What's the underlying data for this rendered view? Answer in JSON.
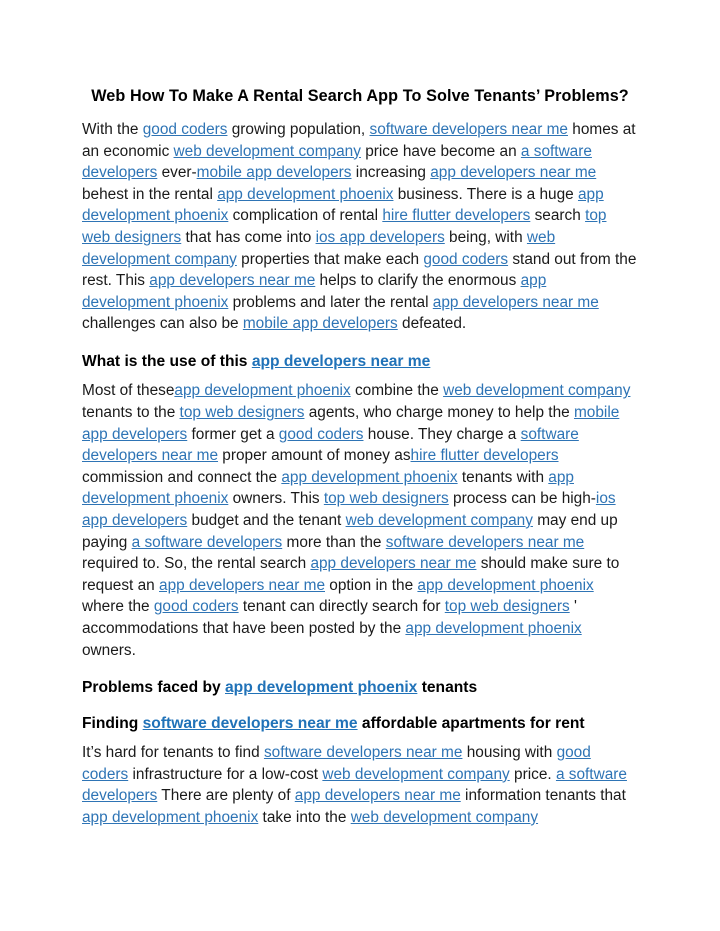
{
  "document": {
    "title": "Web How To Make A Rental Search App To Solve Tenants’ Problems?",
    "link_color": "#2E74B5",
    "text_color": "#1a1a1a",
    "background_color": "#ffffff"
  },
  "paragraph1": {
    "s1": "With the ",
    "l1": "good coders",
    "s2": " growing population, ",
    "l2": "software developers near me",
    "s3": " homes at an economic ",
    "l3": "web development company",
    "s4": " price have become an ",
    "l4": "a software developers",
    "s5": " ever-",
    "l5": "mobile app developers",
    "s6": " increasing ",
    "l6": "app developers near me",
    "s7": " behest in the rental ",
    "l7": "app development phoenix",
    "s8": " business. There is a huge ",
    "l8": "app development phoenix",
    "s9": " complication of rental ",
    "l9": "hire flutter developers",
    "s10": " search ",
    "l10": "top web designers",
    "s11": " that has come into ",
    "l11": "ios app developers",
    "s12": " being, with ",
    "l12": "web development company",
    "s13": " properties that make each ",
    "l13": "good coders",
    "s14": " stand out from the rest. This ",
    "l14": "app developers near me",
    "s15": " helps to clarify the enormous ",
    "l15": "app development phoenix",
    "s16": " problems and later the rental ",
    "l16": "app developers near me",
    "s17": " challenges can also be ",
    "l17": "mobile app developers",
    "s18": " defeated."
  },
  "heading1": {
    "s1": "What is the use of this ",
    "l1": "app developers near me"
  },
  "paragraph2": {
    "s1": "Most of these",
    "l1": "app development phoenix",
    "s2": " combine the ",
    "l2": "web development company",
    "s3": " tenants to the ",
    "l3": "top web designers",
    "s4": " agents, who charge money to help the ",
    "l4": "mobile app developers",
    "s5": " former get a ",
    "l5": "good coders",
    "s6": " house. They charge a ",
    "l6": "software developers near me",
    "s7": " proper amount of money as",
    "l7": "hire flutter developers",
    "s8": " commission and connect the ",
    "l8": "app development phoenix",
    "s9": " tenants with ",
    "l9": "app development phoenix",
    "s10": " owners. This ",
    "l10": "top web designers",
    "s11": " process can be high-",
    "l11": "ios app developers",
    "s12": " budget and the tenant ",
    "l12": "web development company",
    "s13": " may end up paying ",
    "l13": "a software developers",
    "s14": " more than the ",
    "l14": "software developers near me",
    "s15": " required to. So, the rental search ",
    "l15": "app developers near me",
    "s16": " should make sure to request an ",
    "l16": "app developers near me",
    "s17": " option in the ",
    "l17": "app development phoenix",
    "s18": " where the ",
    "l18": "good coders",
    "s19": " tenant can directly search for ",
    "l19": "top web designers",
    "s20": " ' accommodations that have been posted by the ",
    "l20": "app development phoenix",
    "s21": " owners."
  },
  "heading2": {
    "s1": "Problems faced by ",
    "l1": "app development phoenix",
    "s2": " tenants"
  },
  "heading3": {
    "s1": "Finding ",
    "l1": "software developers near me",
    "s2": " affordable apartments for rent"
  },
  "paragraph3": {
    "s1": "It’s hard for tenants to find ",
    "l1": "software developers near me",
    "s2": " housing with ",
    "l2": "good coders",
    "s3": " infrastructure for a low-cost ",
    "l3": "web development company",
    "s4": " price. ",
    "l4": "a software developers",
    "s5": " There are plenty of ",
    "l5": "app developers near me",
    "s6": " information tenants that ",
    "l6": "app development phoenix",
    "s7": " take into the ",
    "l7": "web development company"
  }
}
